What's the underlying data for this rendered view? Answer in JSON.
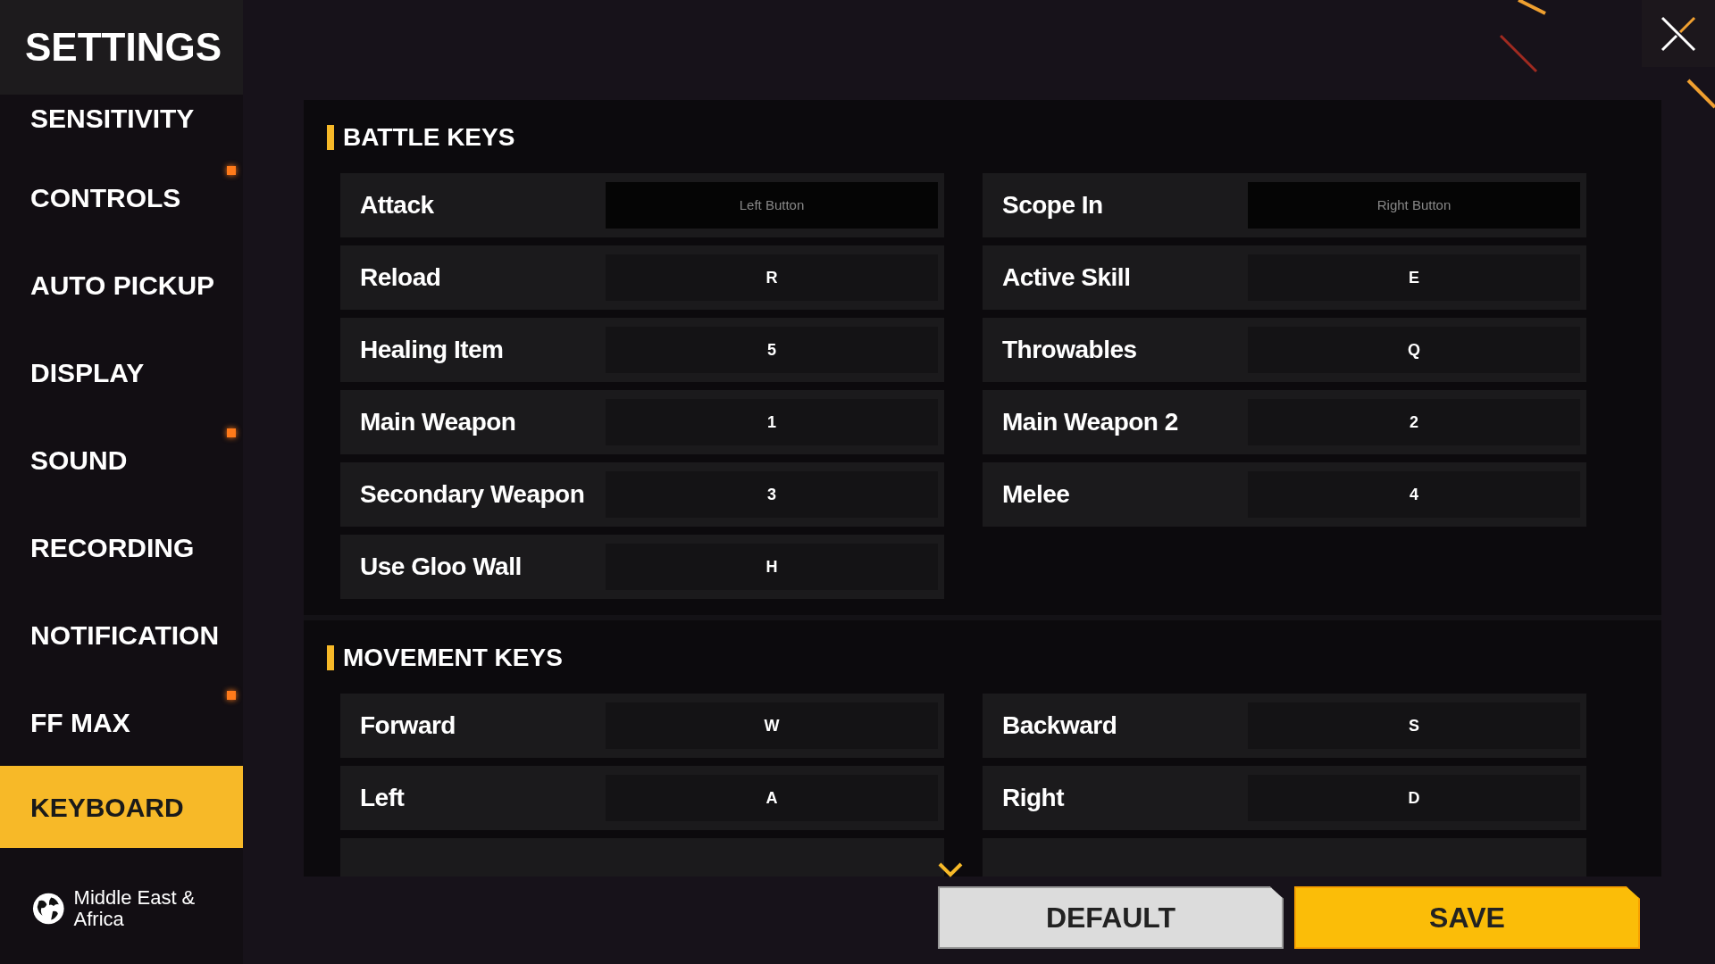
{
  "header": {
    "title": "SETTINGS"
  },
  "sidebar": {
    "items": [
      {
        "label": "SENSITIVITY",
        "selected": false,
        "new": false
      },
      {
        "label": "CONTROLS",
        "selected": false,
        "new": true
      },
      {
        "label": "AUTO PICKUP",
        "selected": false,
        "new": false
      },
      {
        "label": "DISPLAY",
        "selected": false,
        "new": false
      },
      {
        "label": "SOUND",
        "selected": false,
        "new": true
      },
      {
        "label": "RECORDING",
        "selected": false,
        "new": false
      },
      {
        "label": "NOTIFICATION",
        "selected": false,
        "new": false
      },
      {
        "label": "FF MAX",
        "selected": false,
        "new": true
      },
      {
        "label": "KEYBOARD",
        "selected": true,
        "new": false
      }
    ],
    "region": "Middle East & Africa"
  },
  "sections": [
    {
      "title": "BATTLE KEYS",
      "rows": [
        {
          "action": "Attack",
          "key": "Left Button",
          "kind": "mouse"
        },
        {
          "action": "Scope In",
          "key": "Right Button",
          "kind": "mouse"
        },
        {
          "action": "Reload",
          "key": "R",
          "kind": "key"
        },
        {
          "action": "Active Skill",
          "key": "E",
          "kind": "key"
        },
        {
          "action": "Healing Item",
          "key": "5",
          "kind": "key"
        },
        {
          "action": "Throwables",
          "key": "Q",
          "kind": "key"
        },
        {
          "action": "Main Weapon",
          "key": "1",
          "kind": "key"
        },
        {
          "action": "Main Weapon 2",
          "key": "2",
          "kind": "key"
        },
        {
          "action": "Secondary Weapon",
          "key": "3",
          "kind": "key"
        },
        {
          "action": "Melee",
          "key": "4",
          "kind": "key"
        },
        {
          "action": "Use Gloo Wall",
          "key": "H",
          "kind": "key"
        }
      ]
    },
    {
      "title": "MOVEMENT KEYS",
      "rows": [
        {
          "action": "Forward",
          "key": "W",
          "kind": "key"
        },
        {
          "action": "Backward",
          "key": "S",
          "kind": "key"
        },
        {
          "action": "Left",
          "key": "A",
          "kind": "key"
        },
        {
          "action": "Right",
          "key": "D",
          "kind": "key"
        }
      ]
    }
  ],
  "buttons": [
    {
      "label": "DEFAULT",
      "kind": "secondary"
    },
    {
      "label": "SAVE",
      "kind": "primary"
    }
  ]
}
